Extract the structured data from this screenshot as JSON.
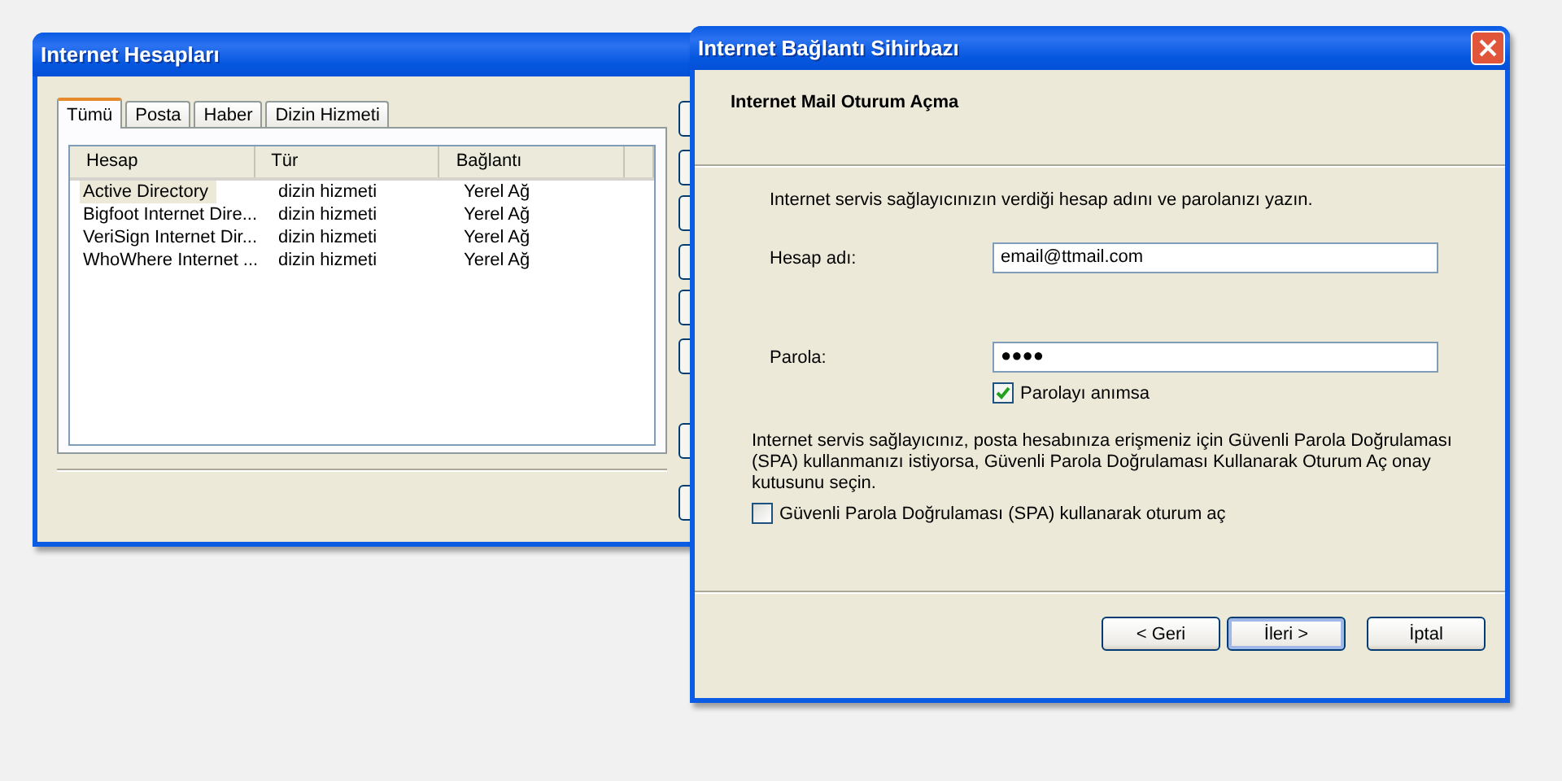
{
  "accounts_window": {
    "title": "Internet Hesapları",
    "tabs": [
      {
        "label": "Tümü",
        "selected": true
      },
      {
        "label": "Posta",
        "selected": false
      },
      {
        "label": "Haber",
        "selected": false
      },
      {
        "label": "Dizin Hizmeti",
        "selected": false
      }
    ],
    "columns": [
      "Hesap",
      "Tür",
      "Bağlantı"
    ],
    "rows": [
      {
        "cells": [
          "Active Directory",
          "dizin hizmeti",
          "Yerel Ağ"
        ],
        "selected": true
      },
      {
        "cells": [
          "Bigfoot Internet Dire...",
          "dizin hizmeti",
          "Yerel Ağ"
        ],
        "selected": false
      },
      {
        "cells": [
          "VeriSign Internet Dir...",
          "dizin hizmeti",
          "Yerel Ağ"
        ],
        "selected": false
      },
      {
        "cells": [
          "WhoWhere Internet ...",
          "dizin hizmeti",
          "Yerel Ağ"
        ],
        "selected": false
      }
    ]
  },
  "wizard_window": {
    "title": "Internet Bağlantı Sihirbazı",
    "heading": "Internet Mail Oturum Açma",
    "instruction": "Internet servis sağlayıcınızın verdiği hesap adını ve parolanızı yazın.",
    "fields": [
      {
        "label": "Hesap adı:",
        "value": "email@ttmail.com"
      },
      {
        "label": "Parola:",
        "value": "●●●●"
      }
    ],
    "remember_password": {
      "label": "Parolayı anımsa",
      "checked": true
    },
    "note": "Internet servis sağlayıcınız, posta hesabınıza erişmeniz için Güvenli Parola Doğrulaması (SPA) kullanmanızı istiyorsa, Güvenli Parola Doğrulaması Kullanarak Oturum Aç onay kutusunu seçin.",
    "spa": {
      "label": "Güvenli Parola Doğrulaması (SPA) kullanarak oturum aç",
      "checked": false
    },
    "buttons": [
      {
        "label": "< Geri",
        "default": false
      },
      {
        "label": "İleri >",
        "default": true
      },
      {
        "label": "İptal",
        "default": false
      }
    ]
  }
}
